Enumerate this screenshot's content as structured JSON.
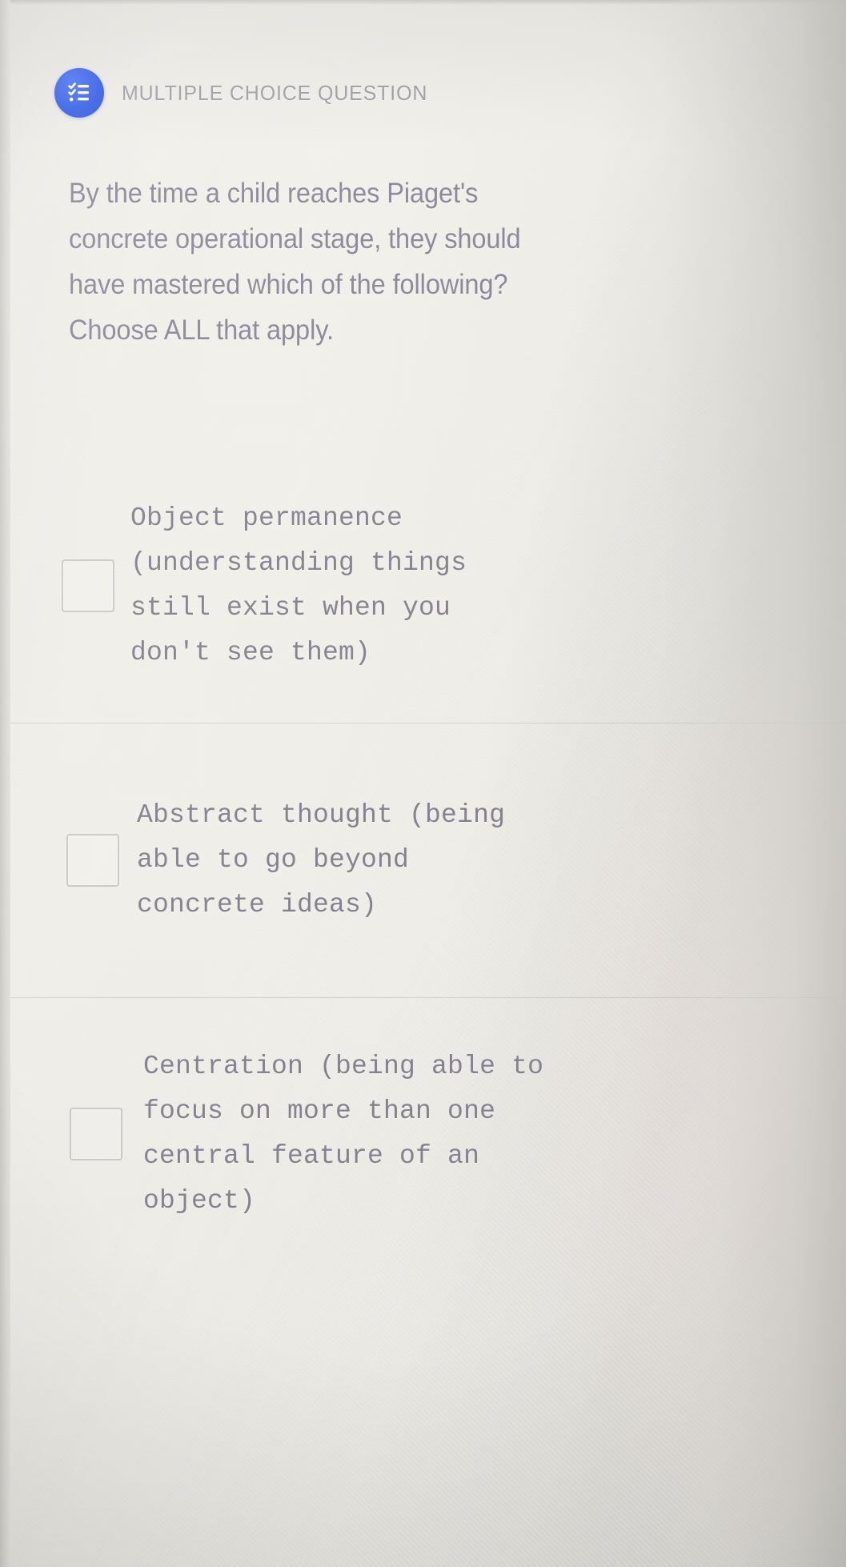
{
  "page": {
    "background_color": "#eceae5",
    "accent_color": "#2f5ae6",
    "question_text_color": "#8b8597",
    "option_text_color": "#87818f",
    "header_label_color": "#9d9aa4"
  },
  "header": {
    "icon": "checklist-icon",
    "label": "MULTIPLE CHOICE QUESTION"
  },
  "question": {
    "stem": "By the time a child reaches Piaget's concrete operational stage, they should have mastered which of the following? Choose ALL that apply."
  },
  "options": [
    {
      "id": "option-1",
      "checkbox": "unchecked",
      "text": "Object permanence\n(understanding things\nstill exist when you\ndon't see them)"
    },
    {
      "id": "option-2",
      "checkbox": "unchecked",
      "text": "Abstract thought (being\nable to go beyond\nconcrete ideas)"
    },
    {
      "id": "option-3",
      "checkbox": "unchecked",
      "text": "Centration (being able to\nfocus on more than one\ncentral feature of an\nobject)"
    }
  ]
}
